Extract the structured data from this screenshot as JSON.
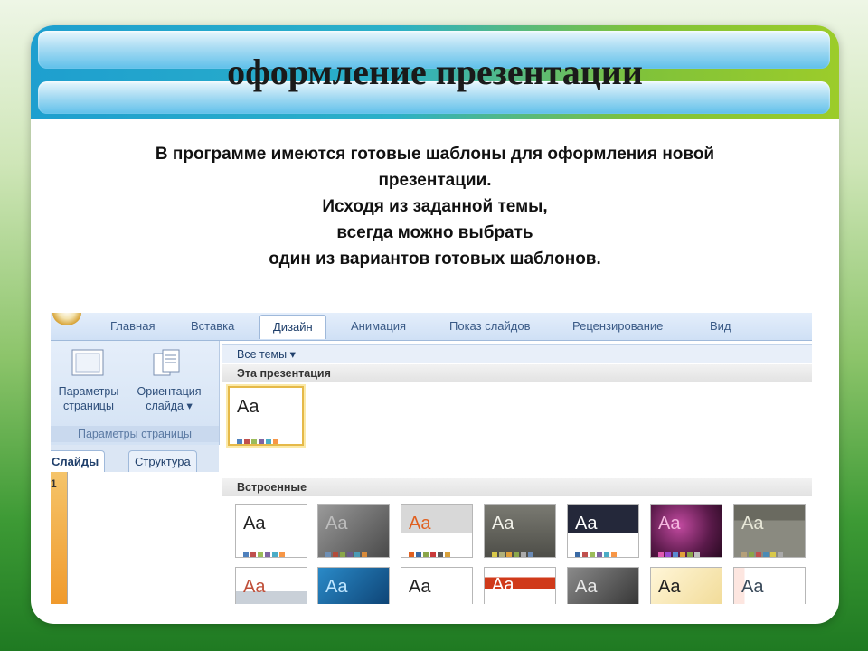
{
  "slide": {
    "title": "оформление презентации",
    "body_lines": [
      "В программе имеются готовые шаблоны для оформления новой",
      "презентации.",
      "Исходя из заданной темы,",
      "всегда можно выбрать",
      "один из вариантов готовых шаблонов."
    ]
  },
  "ribbon": {
    "tabs": [
      "Главная",
      "Вставка",
      "Дизайн",
      "Анимация",
      "Показ слайдов",
      "Рецензирование",
      "Вид"
    ],
    "active_tab": "Дизайн",
    "page_setup_label_1": "Параметры",
    "page_setup_label_2": "страницы",
    "orientation_label_1": "Ориентация",
    "orientation_label_2": "слайда ▾",
    "group_label": "Параметры страницы"
  },
  "slides_panel": {
    "tab_slides": "Слайды",
    "tab_outline": "Структура",
    "slide_number": "1"
  },
  "themes_gallery": {
    "all_themes": "Все темы ▾",
    "this_presentation": "Эта презентация",
    "builtin": "Встроенные",
    "sample_text": "Aa"
  },
  "colors": {
    "header_blue": "#5fc0ea",
    "header_green": "#9ccc2a",
    "ribbon_text": "#3a5a86",
    "selected_border": "#e5b949"
  }
}
